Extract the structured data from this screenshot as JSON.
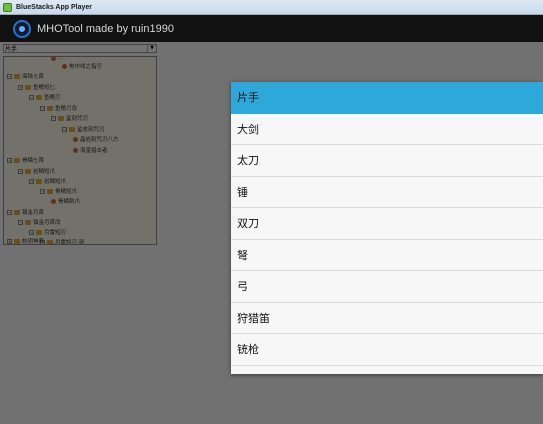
{
  "window": {
    "title": "BlueStacks App Player"
  },
  "appbar": {
    "title": "MHOTool made by ruin1990",
    "logo_icon": "app-logo-icon"
  },
  "content": {
    "selector_value": "片手",
    "tree": [
      {
        "depth": 4,
        "type": "leaf",
        "label": "…"
      },
      {
        "depth": 5,
        "type": "leaf",
        "label": "电中线之指引"
      },
      {
        "depth": 0,
        "type": "folder",
        "label": "海陆七首",
        "expander": "⊟"
      },
      {
        "depth": 1,
        "type": "folder",
        "label": "鱼鳍短匕",
        "expander": "⊟"
      },
      {
        "depth": 2,
        "type": "folder",
        "label": "鱼鳍刃",
        "expander": "⊟"
      },
      {
        "depth": 3,
        "type": "folder",
        "label": "鱼鳍刃改",
        "expander": "⊟"
      },
      {
        "depth": 4,
        "type": "folder",
        "label": "鲨刻咒刃",
        "expander": "⊟"
      },
      {
        "depth": 5,
        "type": "folder",
        "label": "鲨皮刻咒刃",
        "expander": "⊟"
      },
      {
        "depth": 6,
        "type": "leaf",
        "label": "晶岩刻咒刃八方"
      },
      {
        "depth": 6,
        "type": "leaf",
        "label": "海皇猎击者"
      },
      {
        "depth": 0,
        "type": "folder",
        "label": "骨鳞七首",
        "expander": "⊟"
      },
      {
        "depth": 1,
        "type": "folder",
        "label": "岩鳞短爪",
        "expander": "⊟"
      },
      {
        "depth": 2,
        "type": "folder",
        "label": "岩鳞短爪",
        "expander": "⊟"
      },
      {
        "depth": 3,
        "type": "folder",
        "label": "骨鳞短爪",
        "expander": "⊟"
      },
      {
        "depth": 4,
        "type": "leaf",
        "label": "骨鳞刺爪"
      },
      {
        "depth": 0,
        "type": "folder",
        "label": "镇金月首",
        "expander": "⊟"
      },
      {
        "depth": 1,
        "type": "folder",
        "label": "镇金月首改",
        "expander": "⊟"
      },
      {
        "depth": 2,
        "type": "folder",
        "label": "月雷短刃",
        "expander": "⊟"
      },
      {
        "depth": 3,
        "type": "folder",
        "label": "月雷短刃·刻",
        "expander": "⊟"
      },
      {
        "depth": 4,
        "type": "leaf",
        "label": "月雷战刃"
      },
      {
        "depth": 0,
        "type": "folder",
        "label": "皎玥神首",
        "expander": "⊞"
      }
    ]
  },
  "dialog": {
    "selected_index": 0,
    "items": [
      "片手",
      "大剑",
      "太刀",
      "锤",
      "双刀",
      "弩",
      "弓",
      "狩猎笛",
      "铳枪"
    ]
  },
  "colors": {
    "appbar_bg": "#111111",
    "selected_bg": "#2ea8d8",
    "dialog_bg": "#f7f7f7"
  }
}
